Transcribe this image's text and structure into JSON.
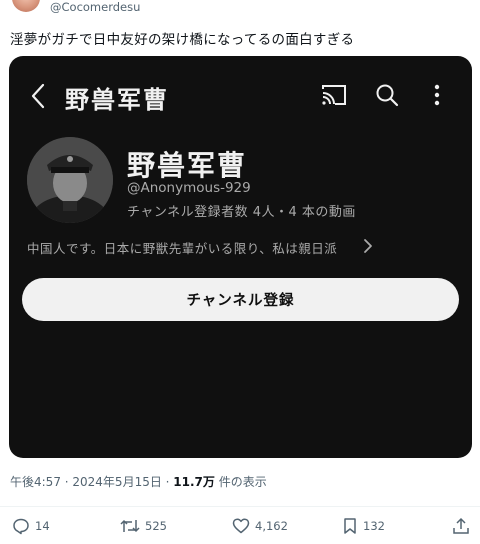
{
  "tweet": {
    "handle": "@Cocomerdesu",
    "text": "淫夢がガチで日中友好の架け橋になってるの面白すぎる",
    "timestamp": "午後4:57 · 2024年5月15日 · ",
    "views_count": "11.7万",
    "views_label": " 件の表示"
  },
  "card": {
    "top_title": "野兽军曹",
    "channel_name": "野兽军曹",
    "channel_handle": "@Anonymous-929",
    "channel_stats": "チャンネル登録者数 4人・4 本の動画",
    "description": "中国人です。日本に野獣先輩がいる限り、私は親日派",
    "subscribe_label": "チャンネル登録",
    "icons": [
      "back-icon",
      "cast-icon",
      "search-icon",
      "more-icon",
      "chevron-right-icon"
    ]
  },
  "actions": {
    "replies": "14",
    "reposts": "525",
    "likes": "4,162",
    "bookmarks": "132"
  },
  "colors": {
    "card_bg": "#101010",
    "button_bg": "#f1f1f1",
    "secondary_text": "#536471"
  }
}
